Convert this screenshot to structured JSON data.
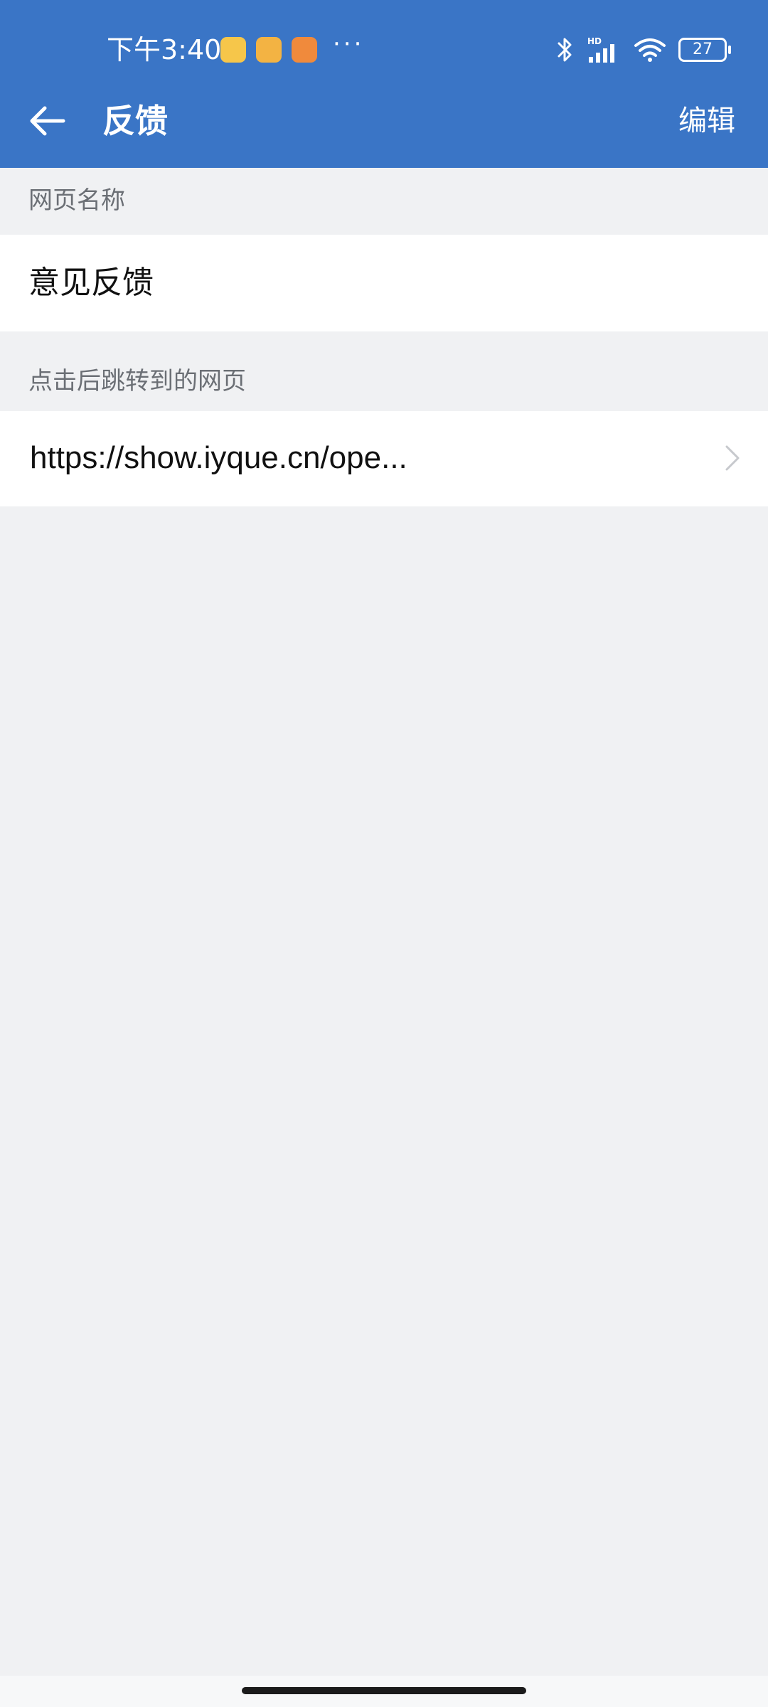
{
  "status_bar": {
    "time": "下午3:40",
    "more": "···",
    "battery": "27",
    "notifications": [
      "weibo-icon",
      "message-icon",
      "app-icon"
    ]
  },
  "toolbar": {
    "title": "反馈",
    "edit_label": "编辑"
  },
  "form": {
    "name_label": "网页名称",
    "name_value": "意见反馈",
    "url_label": "点击后跳转到的网页",
    "url_value": "https://show.iyque.cn/ope..."
  },
  "colors": {
    "header_bg": "#3a75c6",
    "page_bg": "#f0f1f3",
    "row_bg": "#ffffff"
  }
}
